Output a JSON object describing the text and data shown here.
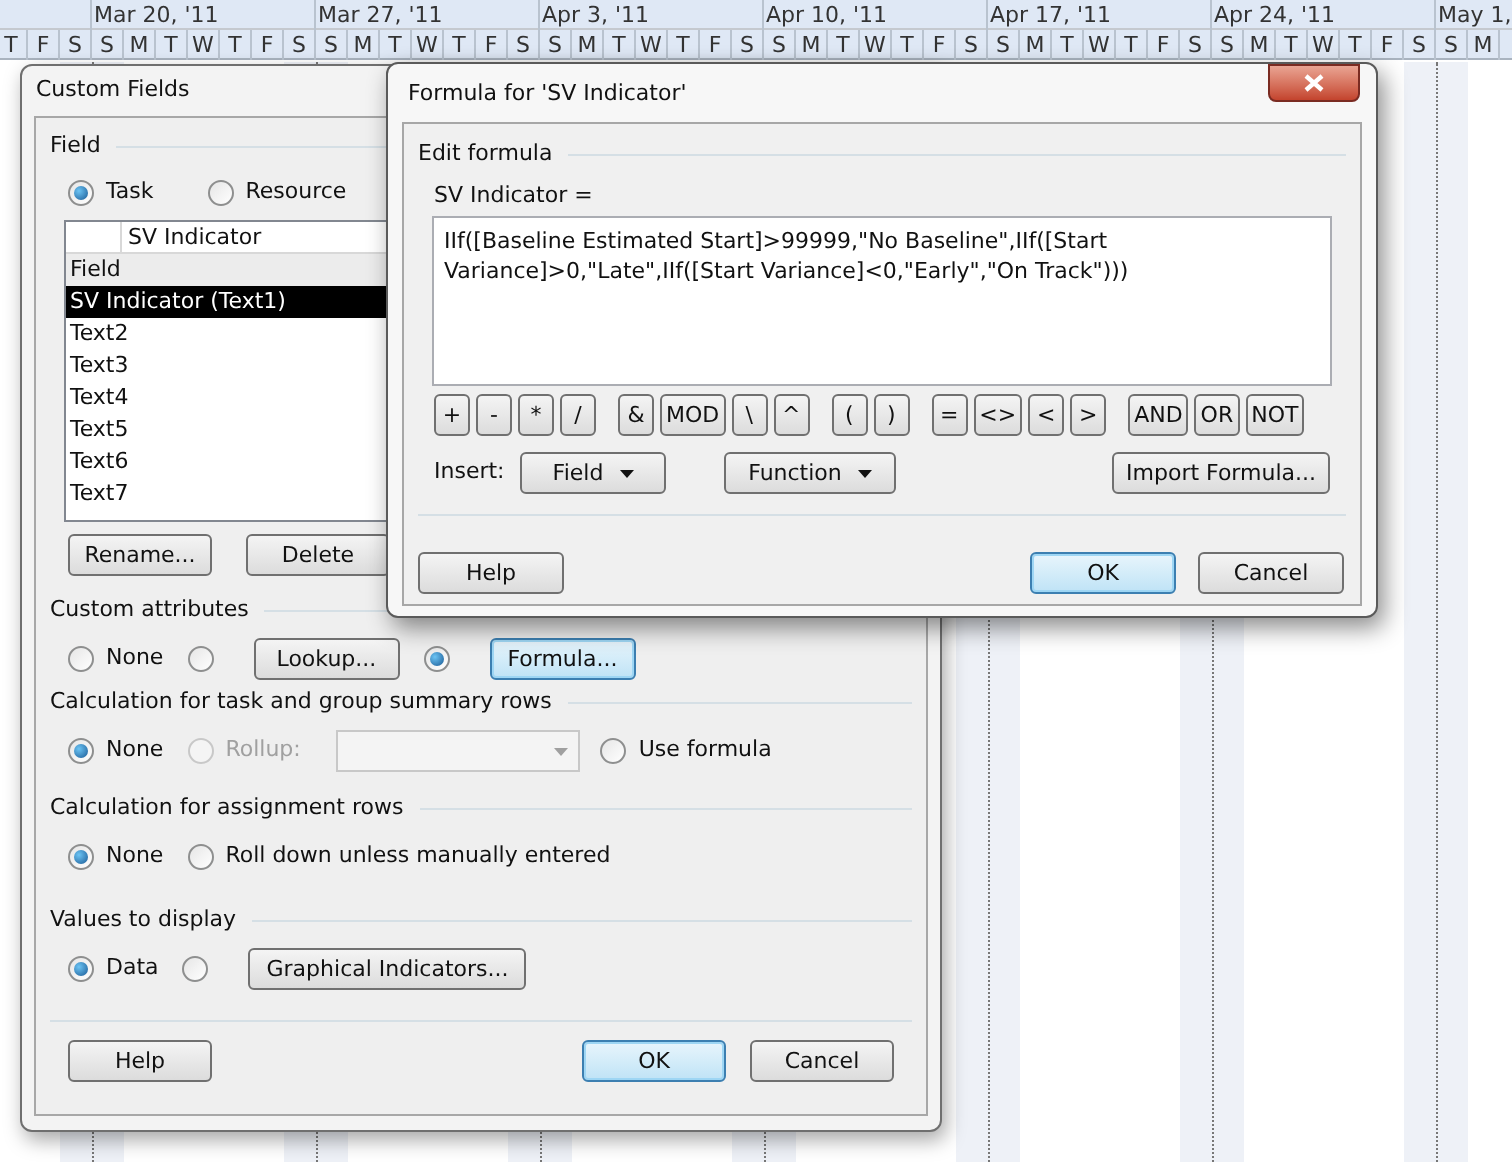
{
  "gantt": {
    "weeks": [
      "Mar 20, '11",
      "Mar 27, '11",
      "Apr 3, '11",
      "Apr 10, '11",
      "Apr 17, '11",
      "Apr 24, '11",
      "May 1,"
    ],
    "days": [
      "T",
      "F",
      "S",
      "S",
      "M",
      "T",
      "W",
      "T",
      "F",
      "S",
      "S",
      "M",
      "T",
      "W",
      "T",
      "F",
      "S",
      "S",
      "M",
      "T",
      "W",
      "T",
      "F",
      "S",
      "S",
      "M",
      "T",
      "W",
      "T",
      "F",
      "S",
      "S",
      "M",
      "T",
      "W",
      "T",
      "F",
      "S",
      "S",
      "M",
      "T",
      "W",
      "T",
      "F",
      "S",
      "S",
      "M"
    ]
  },
  "custom_fields": {
    "title": "Custom Fields",
    "field_group": {
      "label": "Field",
      "types": [
        {
          "label": "Task",
          "selected": true
        },
        {
          "label": "Resource",
          "selected": false
        }
      ],
      "name_entry": {
        "value": "SV Indicator"
      },
      "column_header": "Field",
      "items": [
        {
          "label": "SV Indicator (Text1)",
          "selected": true
        },
        {
          "label": "Text2",
          "selected": false
        },
        {
          "label": "Text3",
          "selected": false
        },
        {
          "label": "Text4",
          "selected": false
        },
        {
          "label": "Text5",
          "selected": false
        },
        {
          "label": "Text6",
          "selected": false
        },
        {
          "label": "Text7",
          "selected": false
        }
      ],
      "buttons": [
        "Rename...",
        "Delete"
      ]
    },
    "sections": [
      {
        "label": "Custom attributes",
        "options": [
          {
            "kind": "radio",
            "label": "None",
            "selected": false,
            "disabled": false
          },
          {
            "kind": "button",
            "label": "Lookup...",
            "selected": false,
            "disabled": false,
            "highlighted": false
          },
          {
            "kind": "button",
            "label": "Formula...",
            "selected": true,
            "disabled": false,
            "highlighted": true
          }
        ]
      },
      {
        "label": "Calculation for task and group summary rows",
        "options": [
          {
            "kind": "radio",
            "label": "None",
            "selected": true,
            "disabled": false
          },
          {
            "kind": "rollup",
            "label": "Rollup:",
            "selected": false,
            "disabled": true
          },
          {
            "kind": "radio",
            "label": "Use formula",
            "selected": false,
            "disabled": false
          }
        ]
      },
      {
        "label": "Calculation for assignment rows",
        "options": [
          {
            "kind": "radio",
            "label": "None",
            "selected": true,
            "disabled": false
          },
          {
            "kind": "radio",
            "label": "Roll down unless manually entered",
            "selected": false,
            "disabled": false
          }
        ]
      },
      {
        "label": "Values to display",
        "options": [
          {
            "kind": "radio",
            "label": "Data",
            "selected": true,
            "disabled": false
          },
          {
            "kind": "button",
            "label": "Graphical Indicators...",
            "selected": false,
            "disabled": false,
            "highlighted": false
          }
        ]
      }
    ],
    "footer": [
      {
        "label": "Help",
        "default": false
      },
      {
        "label": "OK",
        "default": true
      },
      {
        "label": "Cancel",
        "default": false
      }
    ]
  },
  "formula_dialog": {
    "title": "Formula for 'SV Indicator'",
    "group_label": "Edit formula",
    "formula_label": "SV Indicator =",
    "formula": "IIf([Baseline Estimated Start]>99999,\"No Baseline\",IIf([Start Variance]>0,\"Late\",IIf([Start Variance]<0,\"Early\",\"On Track\")))",
    "operators": [
      [
        "+",
        "-",
        "*",
        "/"
      ],
      [
        "&",
        "MOD",
        "\\",
        "^"
      ],
      [
        "(",
        ")"
      ],
      [
        "=",
        "<>",
        "<",
        ">"
      ],
      [
        "AND",
        "OR",
        "NOT"
      ]
    ],
    "insert_label": "Insert:",
    "insert_buttons": [
      {
        "label": "Field",
        "dropdown": true
      },
      {
        "label": "Function",
        "dropdown": true
      },
      {
        "label": "Import Formula...",
        "dropdown": false
      }
    ],
    "footer": [
      {
        "label": "Help",
        "default": false
      },
      {
        "label": "OK",
        "default": true
      },
      {
        "label": "Cancel",
        "default": false
      }
    ]
  }
}
